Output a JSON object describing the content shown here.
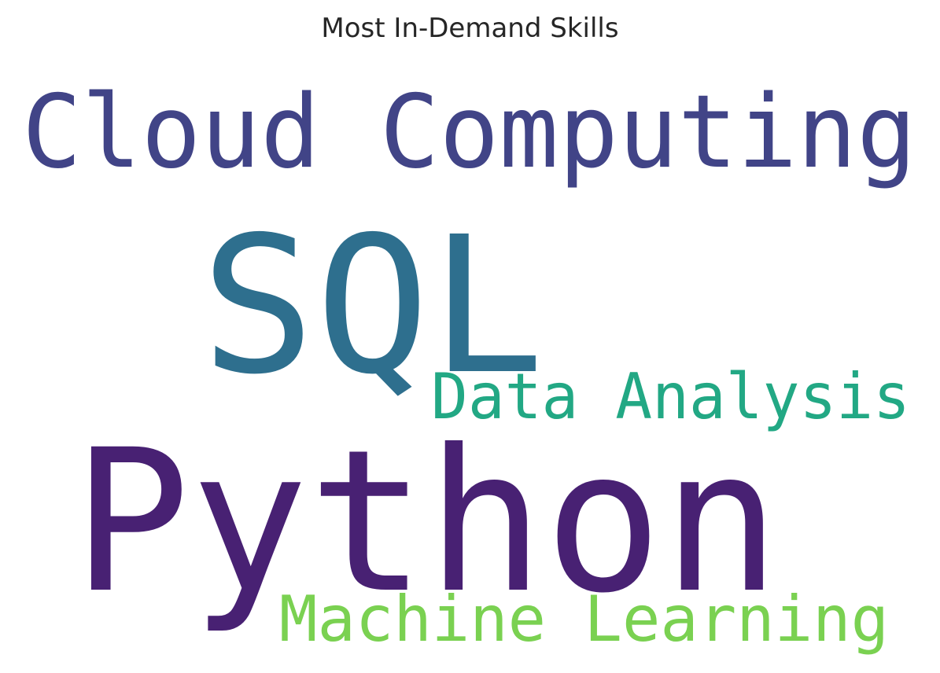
{
  "chart_data": {
    "type": "wordcloud",
    "title": "Most In-Demand Skills",
    "words": [
      {
        "text": "Python",
        "weight": 1.0,
        "color": "#482173"
      },
      {
        "text": "SQL",
        "weight": 0.85,
        "color": "#2e6f8e"
      },
      {
        "text": "Cloud Computing",
        "weight": 0.45,
        "color": "#414487"
      },
      {
        "text": "Data Analysis",
        "weight": 0.3,
        "color": "#22a884"
      },
      {
        "text": "Machine Learning",
        "weight": 0.3,
        "color": "#7ad151"
      }
    ]
  }
}
